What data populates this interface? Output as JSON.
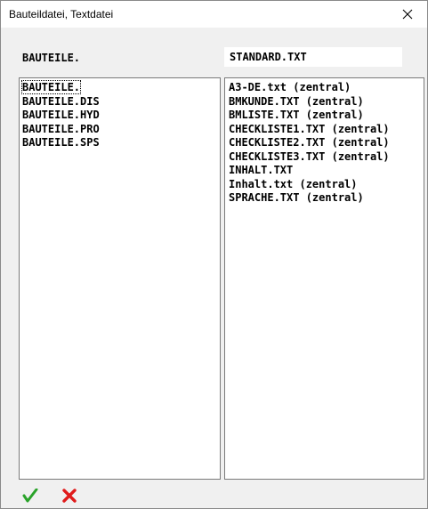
{
  "window": {
    "title": "Bauteildatei, Textdatei"
  },
  "left": {
    "header": "BAUTEILE.",
    "items": [
      "BAUTEILE.",
      "BAUTEILE.DIS",
      "BAUTEILE.HYD",
      "BAUTEILE.PRO",
      "BAUTEILE.SPS"
    ],
    "selected_index": 0
  },
  "right": {
    "field_value": "STANDARD.TXT",
    "items": [
      "A3-DE.txt (zentral)",
      "BMKUNDE.TXT (zentral)",
      "BMLISTE.TXT (zentral)",
      "CHECKLISTE1.TXT (zentral)",
      "CHECKLISTE2.TXT (zentral)",
      "CHECKLISTE3.TXT (zentral)",
      "INHALT.TXT",
      "Inhalt.txt (zentral)",
      "SPRACHE.TXT (zentral)"
    ]
  },
  "footer": {
    "ok_icon": "checkmark-icon",
    "cancel_icon": "x-icon",
    "ok_color": "#2aa32a",
    "cancel_color": "#e01b1b"
  }
}
